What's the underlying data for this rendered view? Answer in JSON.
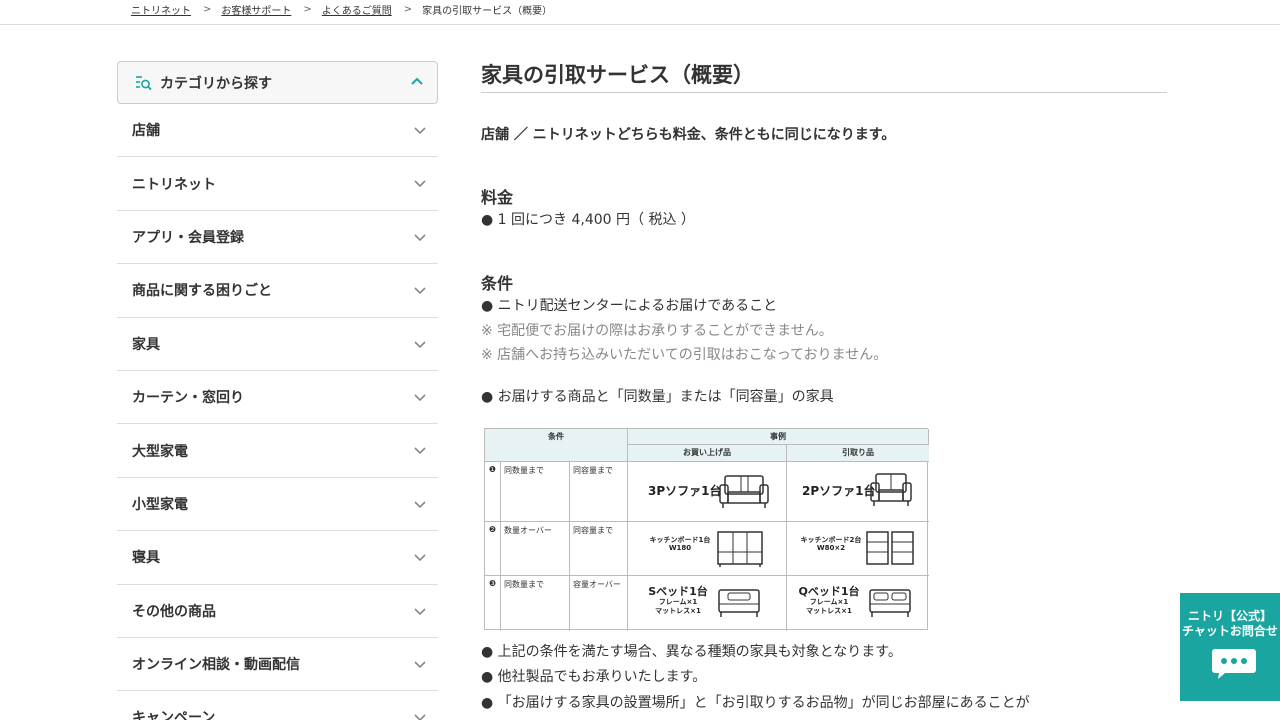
{
  "breadcrumb": {
    "items": [
      "ニトリネット",
      "お客様サポート",
      "よくあるご質問"
    ],
    "current": "家具の引取サービス（概要）"
  },
  "sidebar": {
    "title": "カテゴリから探す",
    "items": [
      {
        "label": "店舗"
      },
      {
        "label": "ニトリネット"
      },
      {
        "label": "アプリ・会員登録"
      },
      {
        "label": "商品に関する困りごと"
      },
      {
        "label": "家具"
      },
      {
        "label": "カーテン・窓回り"
      },
      {
        "label": "大型家電"
      },
      {
        "label": "小型家電"
      },
      {
        "label": "寝具"
      },
      {
        "label": "その他の商品"
      },
      {
        "label": "オンライン相談・動画配信"
      },
      {
        "label": "キャンペーン"
      }
    ]
  },
  "main": {
    "title": "家具の引取サービス（概要）",
    "intro": "店舗 ／ ニトリネットどちらも料金、条件ともに同じになります。",
    "fee_heading": "料金",
    "fee_line": "● 1 回につき 4,400 円（ 税込 ）",
    "cond_heading": "条件",
    "cond_lines": [
      "● ニトリ配送センターによるお届けであること",
      "※ 宅配便でお届けの際はお承りすることができません。",
      "※ 店舗へお持ち込みいただいての引取はおこなっておりません。",
      "● お届けする商品と「同数量」または「同容量」の家具"
    ],
    "after_lines": [
      "● 上記の条件を満たす場合、異なる種類の家具も対象となります。",
      "● 他社製品でもお承りいたします。",
      "● 「お届けする家具の設置場所」と「お引取りするお品物」が同じお部屋にあることが"
    ]
  },
  "table": {
    "h_cond": "条件",
    "h_example": "事例",
    "h_buy": "お買い上げ品",
    "h_take": "引取り品",
    "rows": [
      {
        "num": "❶",
        "c1": "同数量まで",
        "c2": "同容量まで",
        "buy": "3Pソファ1台",
        "buy_sub": "",
        "take": "2Pソファ1台",
        "take_sub": ""
      },
      {
        "num": "❷",
        "c1": "数量オーバー",
        "c2": "同容量まで",
        "buy": "キッチンボード1台",
        "buy_sub": "W180",
        "take": "キッチンボード2台",
        "take_sub": "W80×2"
      },
      {
        "num": "❸",
        "c1": "同数量まで",
        "c2": "容量オーバー",
        "buy": "Sベッド1台",
        "buy_sub": "フレーム×1",
        "buy_sub2": "マットレス×1",
        "take": "Qベッド1台",
        "take_sub": "フレーム×1",
        "take_sub2": "マットレス×1"
      }
    ]
  },
  "chat": {
    "line1": "ニトリ【公式】",
    "line2": "チャットお問合せ"
  },
  "colors": {
    "accent": "#1aa5a0",
    "border": "#dddddd",
    "note": "#888888"
  },
  "icons": {
    "category": "list-search-icon",
    "expand": "chevron-down-icon",
    "collapse": "chevron-up-icon",
    "chat": "chat-bubble-icon"
  }
}
